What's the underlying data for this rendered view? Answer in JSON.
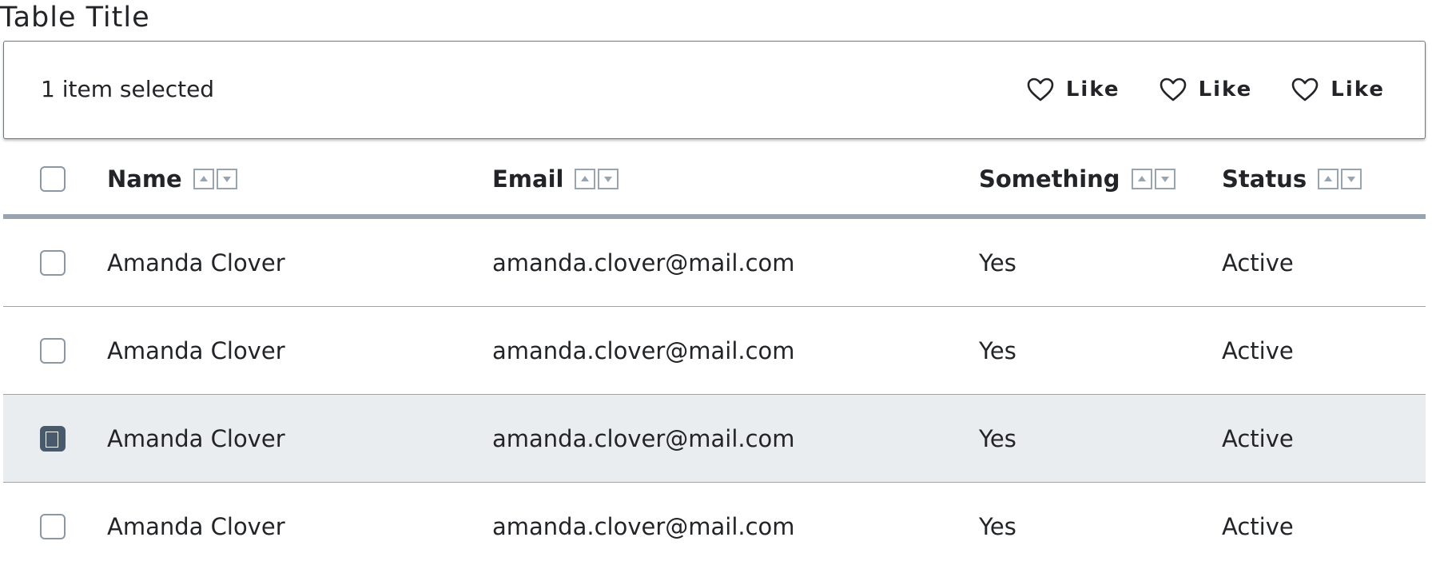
{
  "table": {
    "title": "Table Title"
  },
  "toolbar": {
    "selection_text": "1 item selected",
    "actions": [
      {
        "label": "Like",
        "icon": "heart-outline-icon"
      },
      {
        "label": "Like",
        "icon": "heart-outline-icon"
      },
      {
        "label": "Like",
        "icon": "heart-outline-icon"
      }
    ]
  },
  "columns": [
    {
      "label": "Name"
    },
    {
      "label": "Email"
    },
    {
      "label": "Something"
    },
    {
      "label": "Status"
    }
  ],
  "rows": [
    {
      "name": "Amanda Clover",
      "email": "amanda.clover@mail.com",
      "something": "Yes",
      "status": "Active",
      "selected": false
    },
    {
      "name": "Amanda Clover",
      "email": "amanda.clover@mail.com",
      "something": "Yes",
      "status": "Active",
      "selected": false
    },
    {
      "name": "Amanda Clover",
      "email": "amanda.clover@mail.com",
      "something": "Yes",
      "status": "Active",
      "selected": true
    },
    {
      "name": "Amanda Clover",
      "email": "amanda.clover@mail.com",
      "something": "Yes",
      "status": "Active",
      "selected": false
    }
  ],
  "colors": {
    "text": "#222428",
    "border": "#98a5b0",
    "selected_row": "#e9edf0",
    "checkbox_checked": "#485a6b"
  }
}
